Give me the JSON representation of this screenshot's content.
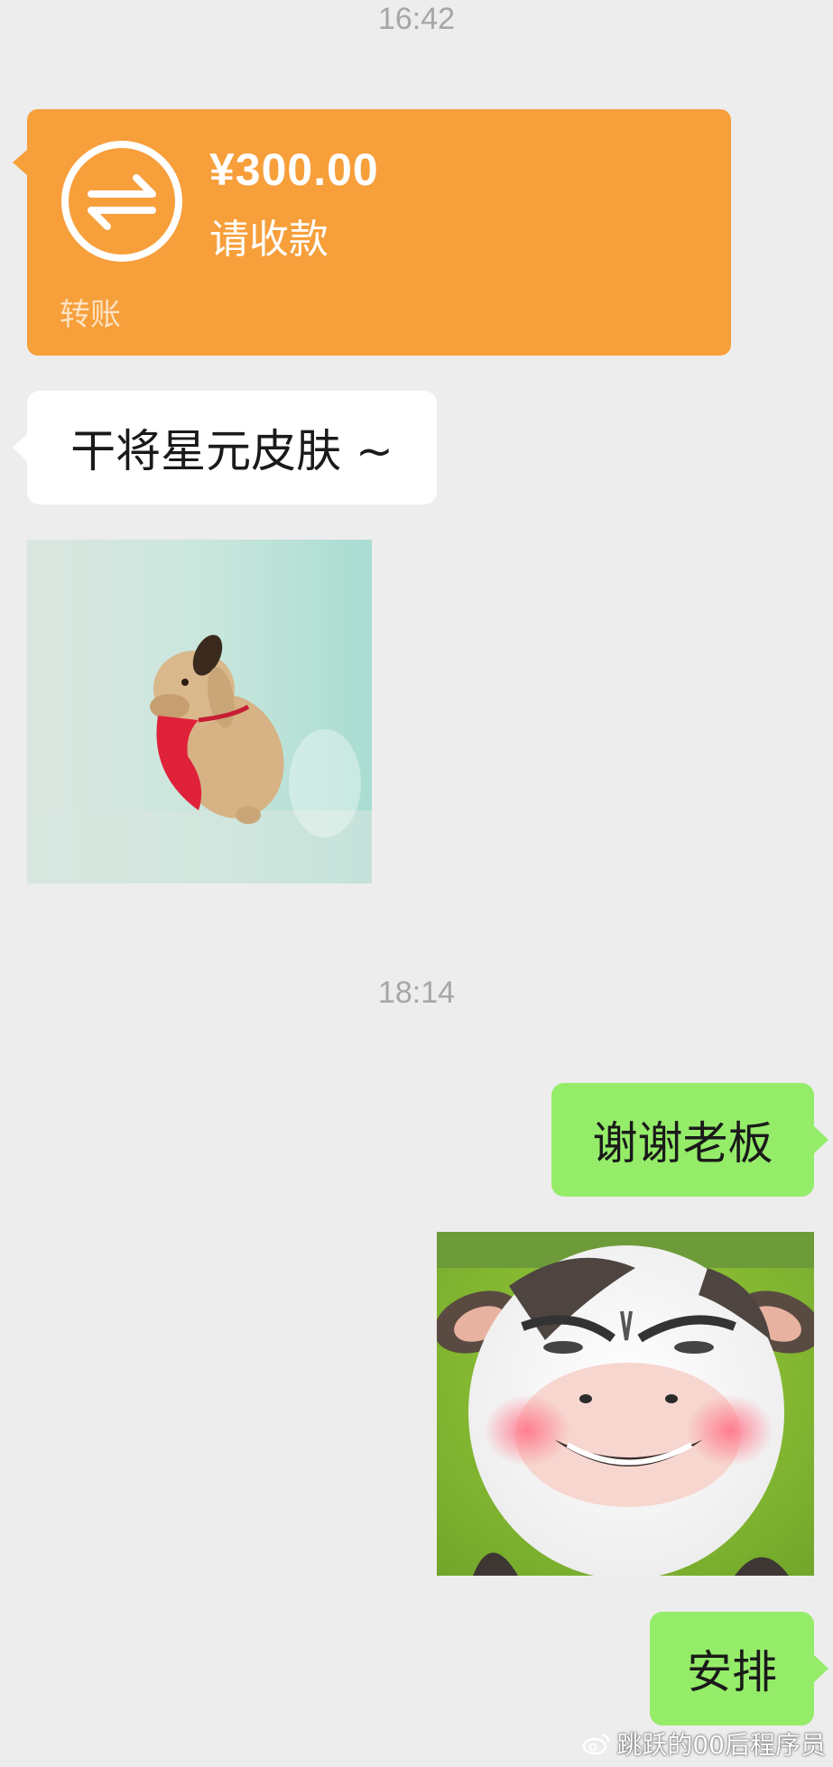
{
  "messages": {
    "time1": "16:42",
    "transfer": {
      "amount": "¥300.00",
      "status": "请收款",
      "label": "转账",
      "icon": "transfer-arrows-icon",
      "color": "#f79f3b"
    },
    "text1": "干将星元皮肤 ~",
    "sticker1": "dog-sticker",
    "time2": "18:14",
    "reply1": "谢谢老板",
    "sticker2": "cow-face-sticker",
    "reply2": "安排"
  },
  "watermark": {
    "text": "跳跃的00后程序员",
    "icon": "weibo-icon"
  },
  "colors": {
    "background": "#ededed",
    "incoming_bubble": "#ffffff",
    "outgoing_bubble": "#95ec69",
    "timestamp": "#a6a6a6"
  }
}
